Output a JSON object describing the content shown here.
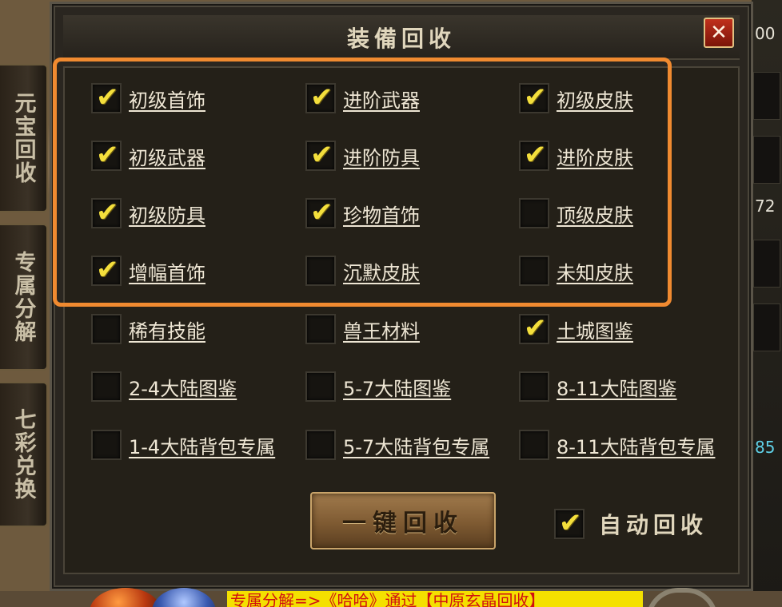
{
  "dialog": {
    "title": "装備回收",
    "close_label": "✕"
  },
  "side_tabs": [
    {
      "label": "元宝回收"
    },
    {
      "label": "专属分解"
    },
    {
      "label": "七彩兑换"
    }
  ],
  "options": [
    {
      "label": "初级首饰",
      "checked": true
    },
    {
      "label": "进阶武器",
      "checked": true
    },
    {
      "label": "初级皮肤",
      "checked": true
    },
    {
      "label": "初级武器",
      "checked": true
    },
    {
      "label": "进阶防具",
      "checked": true
    },
    {
      "label": "进阶皮肤",
      "checked": true
    },
    {
      "label": "初级防具",
      "checked": true
    },
    {
      "label": "珍物首饰",
      "checked": true
    },
    {
      "label": "顶级皮肤",
      "checked": false
    },
    {
      "label": "增幅首饰",
      "checked": true
    },
    {
      "label": "沉默皮肤",
      "checked": false
    },
    {
      "label": "未知皮肤",
      "checked": false
    },
    {
      "label": "稀有技能",
      "checked": false
    },
    {
      "label": "兽王材料",
      "checked": false
    },
    {
      "label": "土城图鉴",
      "checked": true
    },
    {
      "label": "2-4大陆图鉴",
      "checked": false
    },
    {
      "label": "5-7大陆图鉴",
      "checked": false
    },
    {
      "label": "8-11大陆图鉴",
      "checked": false
    },
    {
      "label": "1-4大陆背包专属",
      "checked": false
    },
    {
      "label": "5-7大陆背包专属",
      "checked": false
    },
    {
      "label": "8-11大陆背包专属",
      "checked": false
    }
  ],
  "actions": {
    "recycle_label": "一键回收",
    "auto_label": "自动回收",
    "auto_checked": true
  },
  "hud": {
    "right_text_top": "00",
    "right_text_mid": "72",
    "right_text_bottom": "85",
    "marquee": "专属分解=>《哈哈》通过【中原玄晶回收】"
  },
  "colors": {
    "highlight": "#f08a30",
    "checkmark": "#f4df3c",
    "close_button": "#c0301c"
  }
}
